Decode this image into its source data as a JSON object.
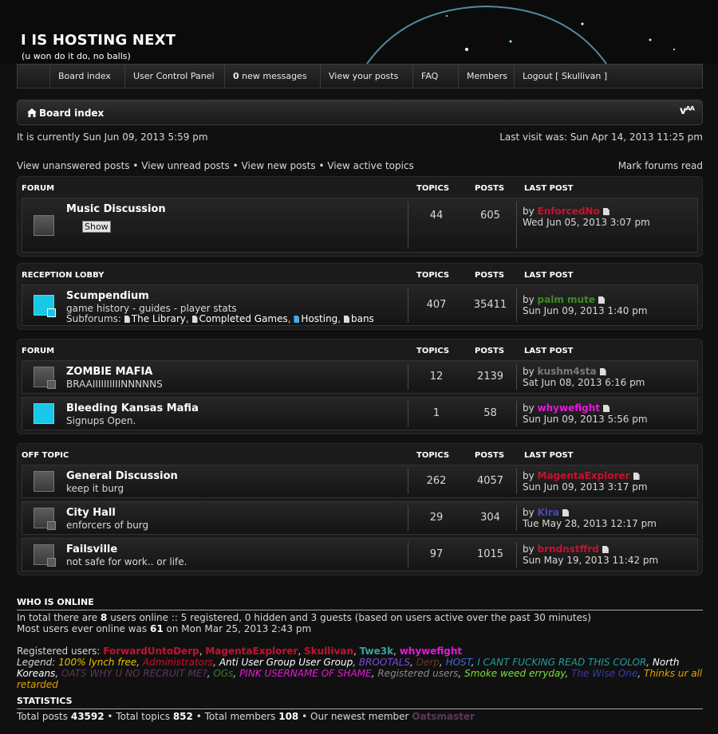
{
  "site": {
    "title": "I IS HOSTING NEXT",
    "description": "(u won do it do, no balls)"
  },
  "nav": [
    {
      "label": "Board index",
      "width": 94,
      "bold": ""
    },
    {
      "label": "User Control Panel",
      "width": 125,
      "bold": ""
    },
    {
      "label": "new messages",
      "width": 120,
      "bold": "0"
    },
    {
      "label": "View your posts",
      "width": 116,
      "bold": ""
    },
    {
      "label": "FAQ",
      "width": 57,
      "bold": ""
    },
    {
      "label": "Members",
      "width": 70,
      "bold": ""
    },
    {
      "label": "Logout [ Skullivan ]",
      "width": 124,
      "bold": ""
    }
  ],
  "breadcrumb": {
    "label": "Board index",
    "font_size_label": "ᴬᴬ"
  },
  "status": {
    "current_time": "It is currently Sun Jun 09, 2013 5:59 pm",
    "last_visit": "Last visit was: Sun Apr 14, 2013 11:25 pm"
  },
  "links": {
    "unanswered": "View unanswered posts",
    "unread": "View unread posts",
    "new": "View new posts",
    "active": "View active topics",
    "mark_read": "Mark forums read",
    "separator": "•"
  },
  "columns": {
    "topics": "TOPICS",
    "posts": "POSTS",
    "last_post": "LAST POST"
  },
  "categories": [
    {
      "name": "FORUM",
      "forums": [
        {
          "title": "Music Discussion",
          "description": "",
          "show_button": "Show",
          "topics": "44",
          "posts": "605",
          "last_by_label": "by",
          "last_user": "EnforcedNo",
          "last_user_color": "#c8102e",
          "last_date": "Wed Jun 05, 2013 3:07 pm",
          "unread": false,
          "has_sub": false
        }
      ]
    },
    {
      "name": "RECEPTION LOBBY",
      "forums": [
        {
          "title": "Scumpendium",
          "description": "game history - guides - player stats",
          "topics": "407",
          "posts": "35411",
          "subforums_label": "Subforums:",
          "subforums": [
            "The Library",
            "Completed Games",
            "Hosting",
            "bans"
          ],
          "last_by_label": "by",
          "last_user": "palm mute",
          "last_user_color": "#3c8a2a",
          "last_date": "Sun Jun 09, 2013 1:40 pm",
          "unread": true,
          "has_sub": true
        }
      ]
    },
    {
      "name": "FORUM",
      "forums": [
        {
          "title": "ZOMBIE MAFIA",
          "description": "BRAAIIIIIIIIIINNNNNS",
          "topics": "12",
          "posts": "2139",
          "last_by_label": "by",
          "last_user": "kushm4sta",
          "last_user_color": "#7a7a7a",
          "last_date": "Sat Jun 08, 2013 6:16 pm",
          "unread": false,
          "has_sub": true
        },
        {
          "title": "Bleeding Kansas Mafia",
          "description": "Signups Open.",
          "topics": "1",
          "posts": "58",
          "last_by_label": "by",
          "last_user": "whywefight",
          "last_user_color": "#e619d8",
          "last_date": "Sun Jun 09, 2013 5:56 pm",
          "unread": true,
          "has_sub": false
        }
      ]
    },
    {
      "name": "OFF TOPIC",
      "forums": [
        {
          "title": "General Discussion",
          "description": "keep it burg",
          "topics": "262",
          "posts": "4057",
          "last_by_label": "by",
          "last_user": "MagentaExplorer",
          "last_user_color": "#c8102e",
          "last_date": "Sun Jun 09, 2013 3:17 pm",
          "unread": false,
          "has_sub": false
        },
        {
          "title": "City Hall",
          "description": "enforcers of burg",
          "topics": "29",
          "posts": "304",
          "last_by_label": "by",
          "last_user": "Kira",
          "last_user_color": "#4a4ab0",
          "last_date": "Tue May 28, 2013 12:17 pm",
          "unread": false,
          "has_sub": true
        },
        {
          "title": "Failsville",
          "description": "not safe for work.. or life.",
          "topics": "97",
          "posts": "1015",
          "last_by_label": "by",
          "last_user": "brndnstffrd",
          "last_user_color": "#c8102e",
          "last_date": "Sun May 19, 2013 11:42 pm",
          "unread": false,
          "has_sub": true
        }
      ]
    }
  ],
  "who_is_online": {
    "title": "WHO IS ONLINE",
    "line1_a": "In total there are",
    "line1_count": "8",
    "line1_b": "users online :: 5 registered, 0 hidden and 3 guests (based on users active over the past 30 minutes)",
    "line2_a": "Most users ever online was",
    "line2_count": "61",
    "line2_b": "on Mon Mar 25, 2013 2:43 pm",
    "registered_label": "Registered users:",
    "registered_users": [
      {
        "name": "ForwardUntoDerp",
        "color": "#c8102e"
      },
      {
        "name": "MagentaExplorer",
        "color": "#c8102e"
      },
      {
        "name": "Skullivan",
        "color": "#c8102e"
      },
      {
        "name": "Twe3k",
        "color": "#3aa0a0"
      },
      {
        "name": "whywefight",
        "color": "#e619d8"
      }
    ],
    "legend_label": "Legend:",
    "legend": [
      {
        "name": "100% lynch free",
        "color": "#e8c200"
      },
      {
        "name": "Administrators",
        "color": "#c8102e"
      },
      {
        "name": "Anti User Group User Group",
        "color": "#ffffff"
      },
      {
        "name": "BROOTALS",
        "color": "#7a4ad8"
      },
      {
        "name": "Derp",
        "color": "#5a3a2a"
      },
      {
        "name": "HOST",
        "color": "#3a6ae0"
      },
      {
        "name": "I CANT FUCKING READ THIS COLOR",
        "color": "#2a9a9a"
      },
      {
        "name": "North Koreans",
        "color": "#ffffff"
      },
      {
        "name": "OATS WHY U NO RECRUIT ME?",
        "color": "#5a3a5a"
      },
      {
        "name": "OGs",
        "color": "#3a7a2a"
      },
      {
        "name": "PINK USERNAME OF SHAME",
        "color": "#e619d8"
      },
      {
        "name": "Registered users",
        "color": "#8a8a8a"
      },
      {
        "name": "Smoke weed erryday",
        "color": "#7ae03a"
      },
      {
        "name": "The Wise One",
        "color": "#3a3ab0"
      },
      {
        "name": "Thinks ur all retarded",
        "color": "#e8a000"
      }
    ]
  },
  "statistics": {
    "title": "STATISTICS",
    "posts_label": "Total posts",
    "posts": "43592",
    "topics_label": "Total topics",
    "topics": "852",
    "members_label": "Total members",
    "members": "108",
    "newest_label": "Our newest member",
    "newest": "Oatsmaster",
    "newest_color": "#5a3a5a"
  }
}
